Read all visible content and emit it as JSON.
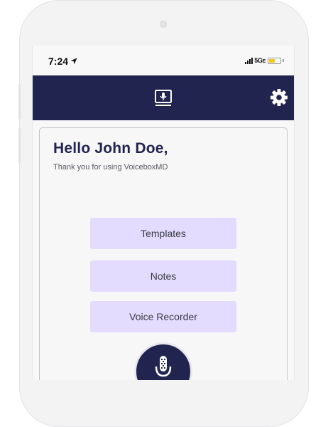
{
  "status_bar": {
    "time": "7:24",
    "network": "5G",
    "network_suffix": "E",
    "battery_level": 0.55,
    "battery_color": "#f5c518"
  },
  "icons": {
    "location": "location-arrow-icon",
    "logo": "voicebox-logo-icon",
    "settings": "gear-icon",
    "mic": "microphone-icon"
  },
  "header": {
    "background": "#222450"
  },
  "home": {
    "greeting": "Hello John Doe,",
    "subtitle": "Thank you for using VoiceboxMD",
    "buttons": [
      {
        "label": "Templates"
      },
      {
        "label": "Notes"
      },
      {
        "label": "Voice Recorder"
      }
    ],
    "button_color": "#e3dcfe"
  }
}
